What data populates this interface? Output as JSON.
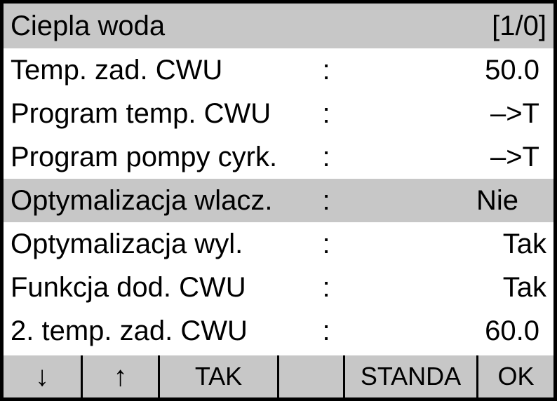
{
  "header": {
    "title": "Ciepla woda",
    "page": "[1/0]"
  },
  "rows": [
    {
      "label": "Temp. zad. CWU",
      "value": "50.0",
      "highlight": false,
      "clipped": false
    },
    {
      "label": "Program temp. CWU",
      "value": "–>T",
      "highlight": false,
      "clipped": false
    },
    {
      "label": "Program pompy cyrk.",
      "value": "–>T",
      "highlight": false,
      "clipped": false
    },
    {
      "label": "Optymalizacja wlacz.",
      "value": "Nie",
      "highlight": true,
      "clipped": false
    },
    {
      "label": "Optymalizacja wyl.",
      "value": "Tak",
      "highlight": false,
      "clipped": true
    },
    {
      "label": "Funkcja dod. CWU",
      "value": "Tak",
      "highlight": false,
      "clipped": true
    },
    {
      "label": "2. temp. zad. CWU",
      "value": "60.0",
      "highlight": false,
      "clipped": false
    }
  ],
  "footer": {
    "down": "↓",
    "up": "↑",
    "tak": "TAK",
    "standa": "STANDA",
    "ok": "OK"
  }
}
